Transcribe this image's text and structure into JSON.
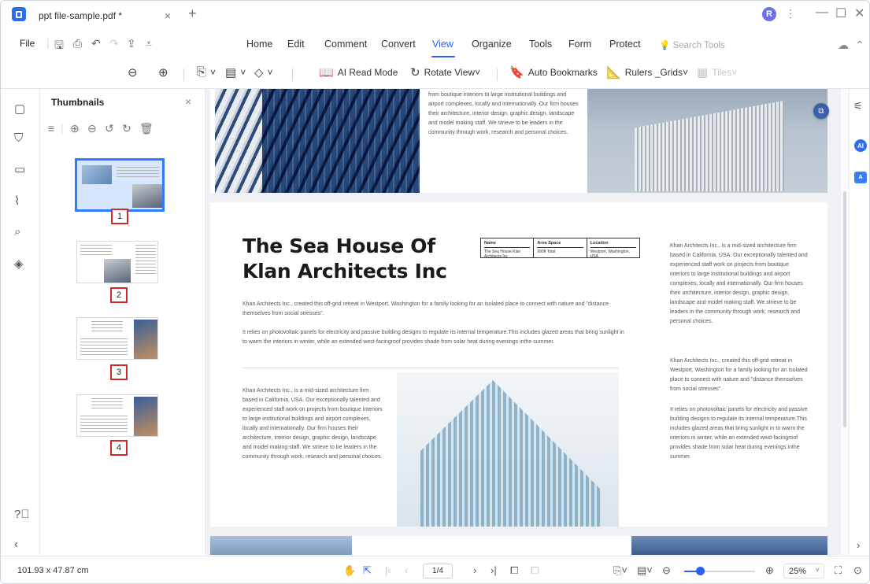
{
  "titlebar": {
    "tab_title": "ppt file-sample.pdf *",
    "avatar_initial": "R"
  },
  "menu": {
    "file": "File",
    "items": [
      "Home",
      "Edit",
      "Comment",
      "Convert",
      "View",
      "Organize",
      "Tools",
      "Form",
      "Protect"
    ],
    "active": "View",
    "search_placeholder": "Search Tools"
  },
  "toolbar": {
    "ai_read_mode": "AI Read Mode",
    "rotate_view": "Rotate View",
    "auto_bookmarks": "Auto Bookmarks",
    "rulers_grids": "Rulers _Grids",
    "tiles": "Tiles"
  },
  "thumbnails": {
    "title": "Thumbnails",
    "pages": [
      "1",
      "2",
      "3",
      "4"
    ],
    "selected_page": "1"
  },
  "document": {
    "page1_text": "from boutique interiors to large institutional buildings and airport complexes, locally and internationally. Our firm houses their architecture, interior design, graphic design, landscape and model making staff. We strieve to be leaders in the community through work, research and personal choices.",
    "headline_line1": "The Sea House Of",
    "headline_line2": "Klan Architects Inc",
    "table": [
      {
        "head": "Name",
        "value": "The Sea House Klan Architects Inc"
      },
      {
        "head": "Area Space",
        "value": "990ft Total"
      },
      {
        "head": "Location",
        "value": "Westport, Washington, USA"
      }
    ],
    "para1": "Khan Architects Inc., created this off-grid retreat in Westport, Washington for a family looking for an isolated place to connect with nature and \"distance themselves from social stresses\".",
    "para2": "It relies on photovoltaic panels for electricity and passive building designs to regulate its internal temperature.This includes glazed areas that bring sunlight in to warm the interiors in winter, while an extended west-facingroof provides shade from solar heat during evenings inthe summer.",
    "lower_left": "Khan Architects Inc., is a mid-sized architecture firm based in California, USA. Our exceptionally talented and experienced staff work on projects from boutique interiors to large institutional buildings and airport complexes, locally and internationally. Our firm houses their architecture, interior design, graphic design, landscape and model making staff. We strieve to be leaders in the community through work, research and personal choices.",
    "right_col_1": "Khan Architects Inc., is a mid-sized architecture firm based in California, USA. Our exceptionally talented and experienced staff work on projects from boutique interiors to large institutional buildings and airport complexes, locally and internationally. Our firm houses their architecture, interior design, graphic design, landscape and model making staff. We strieve to be leaders in the community through work, research and personal choices.",
    "right_col_2": "Khan Architects Inc., created this off-grid retreat in Westport, Washington for a family looking for an isolated place to connect with nature and \"distance themselves from social stresses\".",
    "right_col_3": "It relies on photovoltaic panels for electricity and passive building designs to regulate its internal temperature.This includes glazed areas that bring sunlight in to warm the interiors in winter, while an extended west-facingroof provides shade from solar heat during evenings inthe summer."
  },
  "statusbar": {
    "dimensions": "101.93 x 47.87 cm",
    "page_indicator": "1/4",
    "zoom": "25%"
  },
  "colors": {
    "accent": "#2e5ef0",
    "page_marker": "#d02b2b"
  },
  "icons": [
    "app-logo-icon",
    "close-icon",
    "plus-icon",
    "save-icon",
    "print-icon",
    "undo-icon",
    "redo-icon",
    "share-icon",
    "zoom-out-icon",
    "zoom-in-icon",
    "select-icon",
    "markup-icon",
    "highlight-icon",
    "thumbnail-icon",
    "bookmark-icon",
    "comment-icon",
    "attachment-icon",
    "search-icon",
    "layers-icon",
    "help-icon",
    "hand-icon",
    "pointer-icon",
    "fit-icon",
    "settings-icon",
    "ai-icon"
  ]
}
